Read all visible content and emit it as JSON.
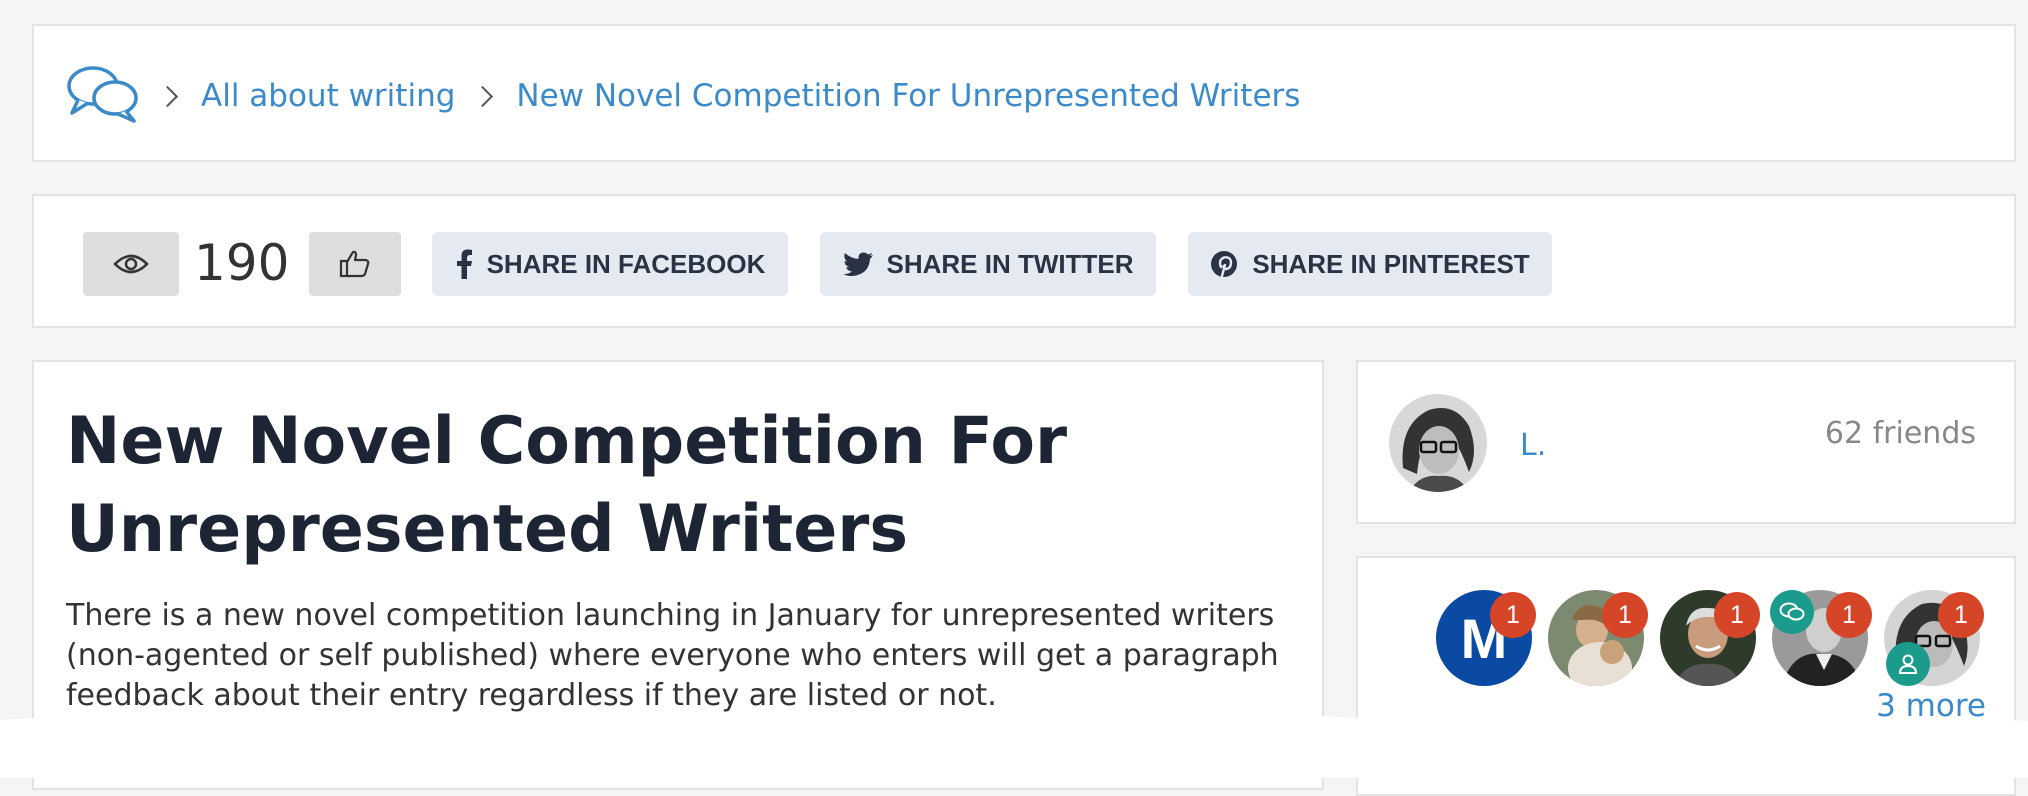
{
  "breadcrumb": {
    "icon": "chat-bubbles-icon",
    "items": [
      {
        "label": "All about writing"
      },
      {
        "label": "New Novel Competition For Unrepresented Writers"
      }
    ]
  },
  "stats": {
    "views_icon": "eye-icon",
    "views": "190",
    "like_icon": "thumbs-up-icon"
  },
  "share": {
    "facebook": {
      "label": "SHARE IN FACEBOOK",
      "icon": "facebook-icon"
    },
    "twitter": {
      "label": "SHARE IN TWITTER",
      "icon": "twitter-icon"
    },
    "pinterest": {
      "label": "SHARE IN PINTEREST",
      "icon": "pinterest-icon"
    }
  },
  "article": {
    "title": "New Novel Competition For Unrepresented Writers",
    "body": "There is a new novel competition launching in January for unrepresented writers (non-agented or self published) where everyone who enters will get a paragraph feedback about their entry regardless if they are listed or not."
  },
  "author": {
    "name": "L.",
    "friends": "62 friends"
  },
  "participants": {
    "avatars": [
      {
        "initial": "M",
        "badge": "1"
      },
      {
        "badge": "1"
      },
      {
        "badge": "1"
      },
      {
        "badge": "1",
        "status_icon": "chat-icon"
      },
      {
        "badge": "1",
        "status_icon": "user-icon"
      }
    ],
    "more": "3 more"
  },
  "colors": {
    "link": "#3b8ac9",
    "badge": "#d64527",
    "teal": "#1a9b8c",
    "button_gray": "#dedede",
    "share_bg": "#e5eaf2"
  }
}
